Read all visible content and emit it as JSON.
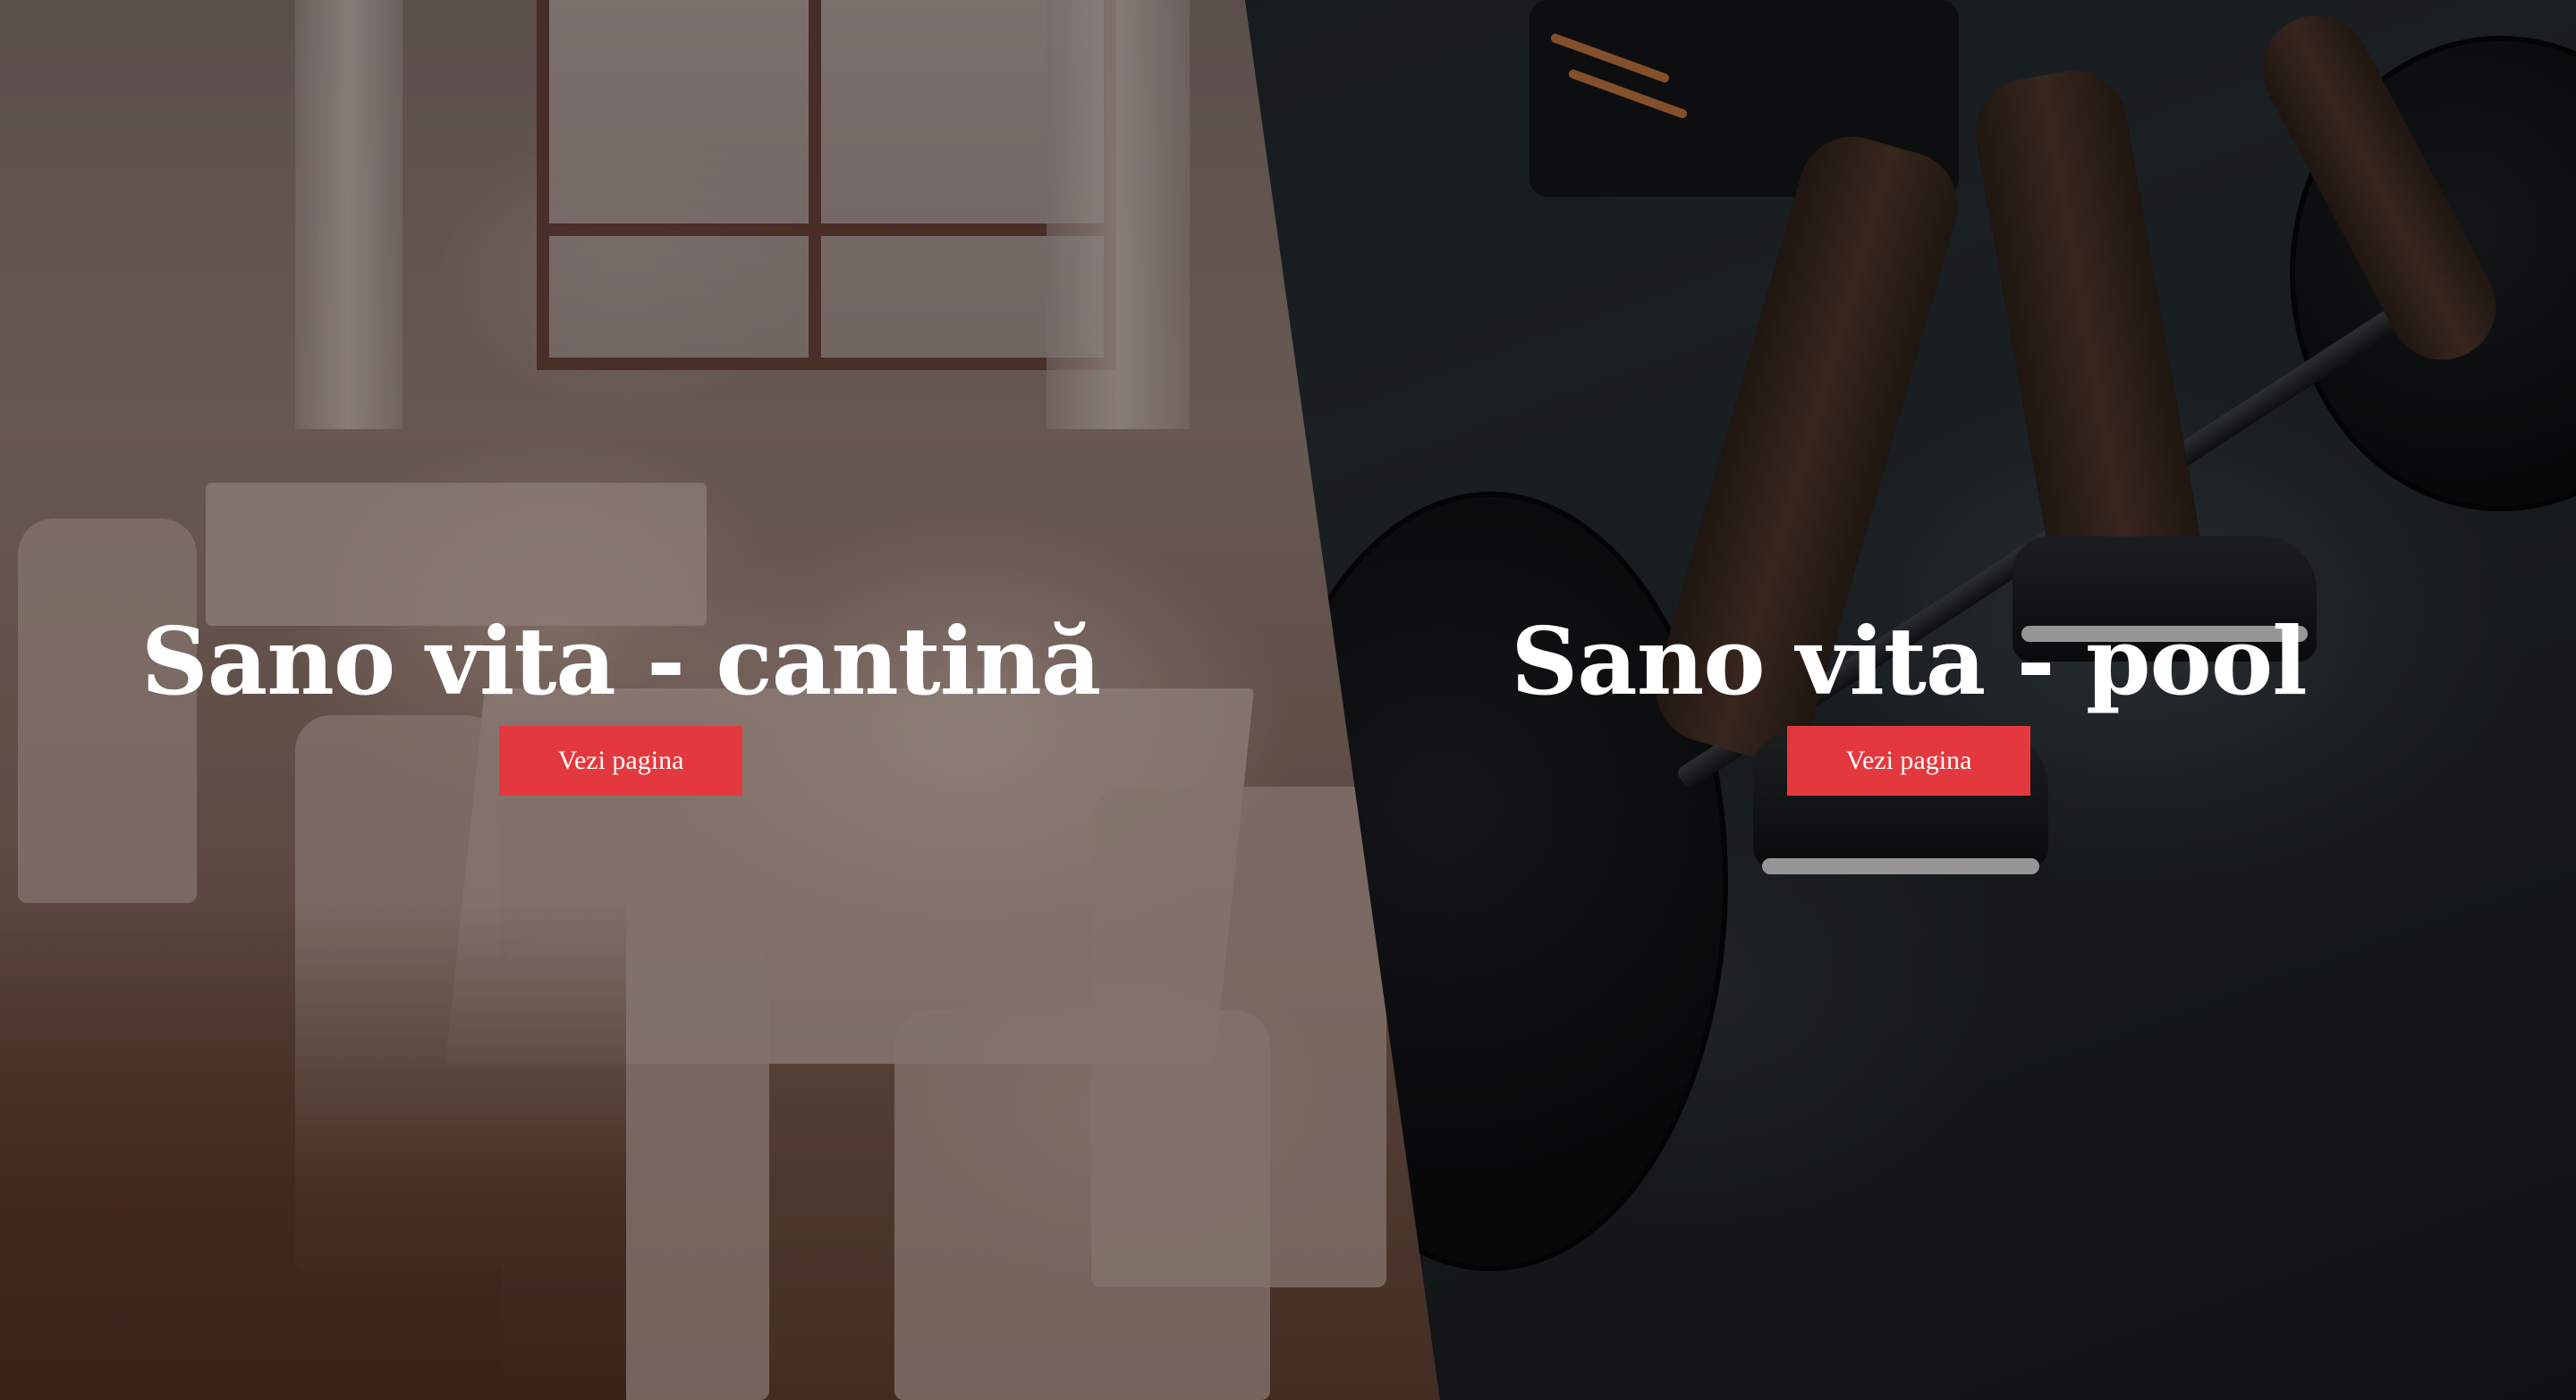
{
  "sections": [
    {
      "title": "Sano vita - cantină",
      "button_label": "Vezi pagina",
      "image": "restaurant-dining-room"
    },
    {
      "title": "Sano vita - pool",
      "button_label": "Vezi pagina",
      "image": "gym-deadlift"
    }
  ],
  "colors": {
    "button": "#e3393e",
    "title_text": "#ffffff",
    "button_text": "#ffffff"
  }
}
